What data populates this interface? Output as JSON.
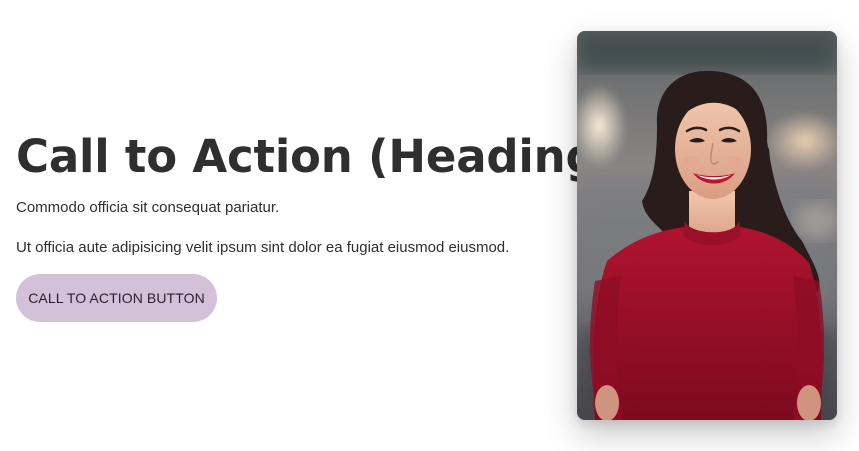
{
  "cta": {
    "heading": "Call to Action (Heading)",
    "paragraph_1": "Commodo officia sit consequat pariatur.",
    "paragraph_2": "Ut officia aute adipisicing velit ipsum sint dolor ea fugiat eiusmod eiusmod.",
    "button_label": "CALL TO ACTION BUTTON"
  },
  "colors": {
    "button_background": "#d3c0d9",
    "heading_text": "#2f2f2f",
    "dress_red": "#a5102a"
  }
}
